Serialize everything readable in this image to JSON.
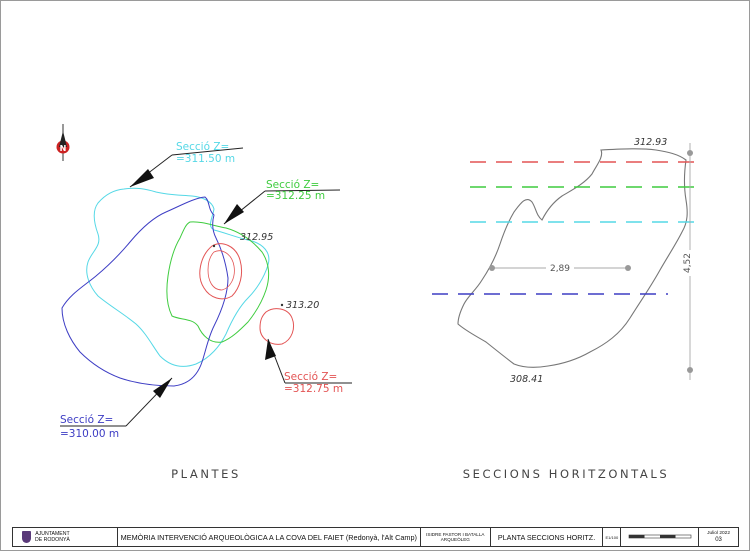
{
  "north_arrow": {
    "letter": "N"
  },
  "plan_view": {
    "caption": "PLANTES",
    "sections": [
      {
        "label": "Secció Z=",
        "value": "=311.50 m",
        "color": "#55d8e6"
      },
      {
        "label": "Secció Z=",
        "value": "=312.25 m",
        "color": "#3fcc3f"
      },
      {
        "label": "Secció Z=",
        "value": "=312.75 m",
        "color": "#e35454"
      },
      {
        "label": "Secció Z=",
        "value": "=310.00 m",
        "color": "#3d3dc4"
      }
    ],
    "spot_heights": [
      "312.95",
      "313.20"
    ]
  },
  "section_view": {
    "caption": "SECCIONS HORITZONTALS",
    "top_elevation": "312.93",
    "bottom_elevation": "308.41",
    "width_dimension": "2,89",
    "height_dimension": "4,52"
  },
  "title_block": {
    "org_line1": "AJUNTAMENT",
    "org_line2": "DE RODONYÀ",
    "project": "MEMÒRIA INTERVENCIÓ ARQUEOLÒGICA A LA COVA DEL FAIET  (Redonyà, l'Alt Camp)",
    "author_line1": "ISIDRE PASTOR I BATALLA",
    "author_line2": "ARQUEÒLEG",
    "plan_title": "PLANTA SECCIONS HORITZ.",
    "scale": "E1/100",
    "date": "Juliol 2022",
    "sheet_number": "03"
  }
}
